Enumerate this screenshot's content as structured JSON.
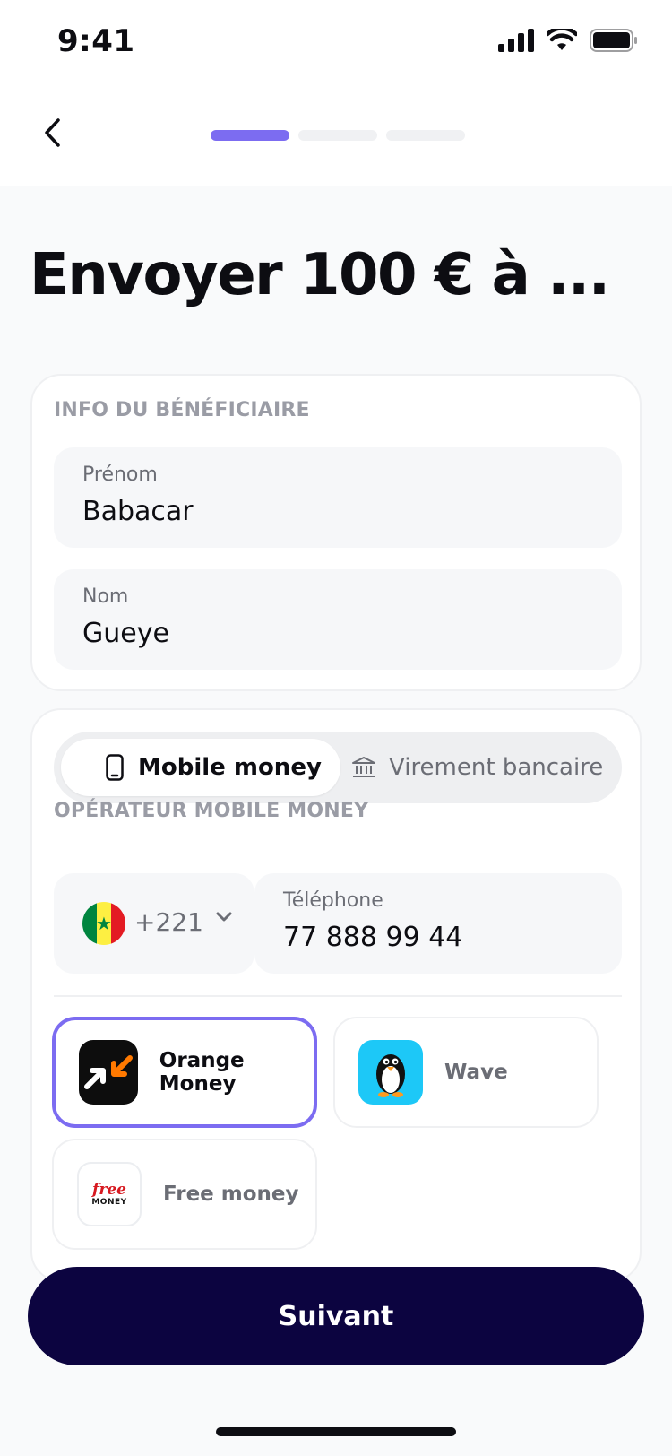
{
  "status_bar": {
    "time": "9:41"
  },
  "nav": {
    "steps": 3,
    "current_step": 1
  },
  "page": {
    "title": "Envoyer 100 € à ..."
  },
  "beneficiary": {
    "section_label": "INFO DU BÉNÉFICIAIRE",
    "first_name_label": "Prénom",
    "first_name_value": "Babacar",
    "last_name_label": "Nom",
    "last_name_value": "Gueye"
  },
  "payment_method": {
    "tabs": [
      {
        "label": "Mobile money",
        "icon": "phone-icon",
        "selected": true
      },
      {
        "label": "Virement bancaire",
        "icon": "bank-icon",
        "selected": false
      }
    ]
  },
  "operator_section": {
    "section_label": "OPÉRATEUR MOBILE MONEY",
    "country_code": "+221",
    "country_flag": "senegal-flag",
    "phone_label": "Téléphone",
    "phone_value": "77 888 99 44"
  },
  "operators": [
    {
      "name": "Orange Money",
      "logo": "orange-money-logo",
      "selected": true
    },
    {
      "name": "Wave",
      "logo": "wave-penguin-logo",
      "selected": false
    },
    {
      "name": "Free money",
      "logo": "free-money-logo",
      "logo_text_top": "free",
      "logo_text_bottom": "MONEY",
      "selected": false
    }
  ],
  "footer": {
    "next_label": "Suivant"
  },
  "colors": {
    "accent": "#7c6cf1",
    "primary_button": "#0c0440",
    "orange": "#ff7900",
    "wave_blue": "#1dc8f7"
  }
}
